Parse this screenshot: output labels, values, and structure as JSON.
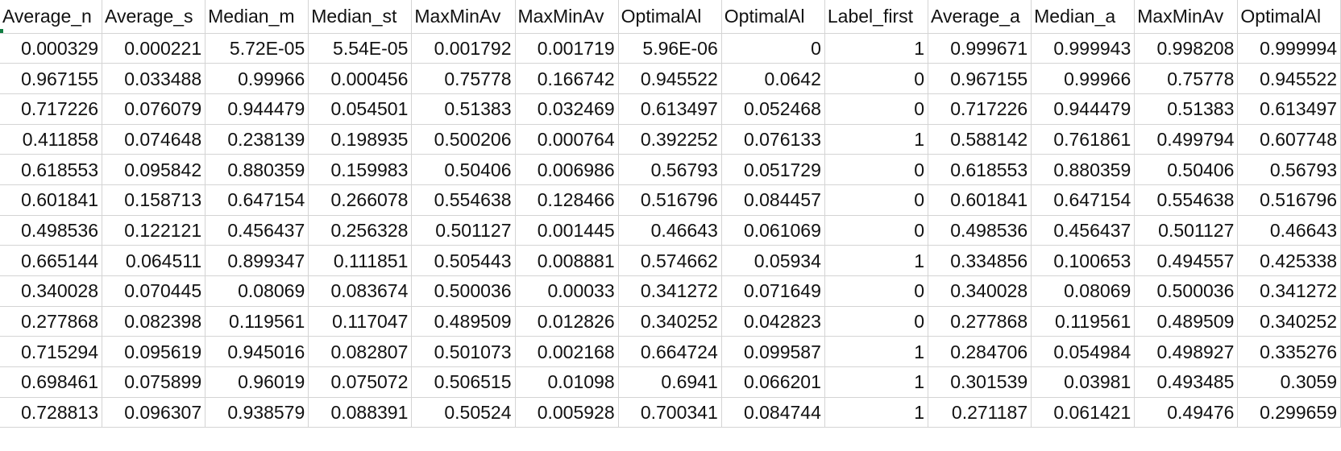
{
  "sheet": {
    "headers": [
      "Average_n",
      "Average_s",
      "Median_m",
      "Median_st",
      "MaxMinAv",
      "MaxMinAv",
      "OptimalAl",
      "OptimalAl",
      "Label_first",
      "Average_a",
      "Median_a",
      "MaxMinAv",
      "OptimalAl"
    ],
    "rows": [
      [
        "0.000329",
        "0.000221",
        "5.72E-05",
        "5.54E-05",
        "0.001792",
        "0.001719",
        "5.96E-06",
        "0",
        "1",
        "0.999671",
        "0.999943",
        "0.998208",
        "0.999994"
      ],
      [
        "0.967155",
        "0.033488",
        "0.99966",
        "0.000456",
        "0.75778",
        "0.166742",
        "0.945522",
        "0.0642",
        "0",
        "0.967155",
        "0.99966",
        "0.75778",
        "0.945522"
      ],
      [
        "0.717226",
        "0.076079",
        "0.944479",
        "0.054501",
        "0.51383",
        "0.032469",
        "0.613497",
        "0.052468",
        "0",
        "0.717226",
        "0.944479",
        "0.51383",
        "0.613497"
      ],
      [
        "0.411858",
        "0.074648",
        "0.238139",
        "0.198935",
        "0.500206",
        "0.000764",
        "0.392252",
        "0.076133",
        "1",
        "0.588142",
        "0.761861",
        "0.499794",
        "0.607748"
      ],
      [
        "0.618553",
        "0.095842",
        "0.880359",
        "0.159983",
        "0.50406",
        "0.006986",
        "0.56793",
        "0.051729",
        "0",
        "0.618553",
        "0.880359",
        "0.50406",
        "0.56793"
      ],
      [
        "0.601841",
        "0.158713",
        "0.647154",
        "0.266078",
        "0.554638",
        "0.128466",
        "0.516796",
        "0.084457",
        "0",
        "0.601841",
        "0.647154",
        "0.554638",
        "0.516796"
      ],
      [
        "0.498536",
        "0.122121",
        "0.456437",
        "0.256328",
        "0.501127",
        "0.001445",
        "0.46643",
        "0.061069",
        "0",
        "0.498536",
        "0.456437",
        "0.501127",
        "0.46643"
      ],
      [
        "0.665144",
        "0.064511",
        "0.899347",
        "0.111851",
        "0.505443",
        "0.008881",
        "0.574662",
        "0.05934",
        "1",
        "0.334856",
        "0.100653",
        "0.494557",
        "0.425338"
      ],
      [
        "0.340028",
        "0.070445",
        "0.08069",
        "0.083674",
        "0.500036",
        "0.00033",
        "0.341272",
        "0.071649",
        "0",
        "0.340028",
        "0.08069",
        "0.500036",
        "0.341272"
      ],
      [
        "0.277868",
        "0.082398",
        "0.119561",
        "0.117047",
        "0.489509",
        "0.012826",
        "0.340252",
        "0.042823",
        "0",
        "0.277868",
        "0.119561",
        "0.489509",
        "0.340252"
      ],
      [
        "0.715294",
        "0.095619",
        "0.945016",
        "0.082807",
        "0.501073",
        "0.002168",
        "0.664724",
        "0.099587",
        "1",
        "0.284706",
        "0.054984",
        "0.498927",
        "0.335276"
      ],
      [
        "0.698461",
        "0.075899",
        "0.96019",
        "0.075072",
        "0.506515",
        "0.01098",
        "0.6941",
        "0.066201",
        "1",
        "0.301539",
        "0.03981",
        "0.493485",
        "0.3059"
      ],
      [
        "0.728813",
        "0.096307",
        "0.938579",
        "0.088391",
        "0.50524",
        "0.005928",
        "0.700341",
        "0.084744",
        "1",
        "0.271187",
        "0.061421",
        "0.49476",
        "0.299659"
      ]
    ]
  },
  "colors": {
    "gridline": "#d4d4d4",
    "selection": "#107c41",
    "text": "#111111"
  }
}
